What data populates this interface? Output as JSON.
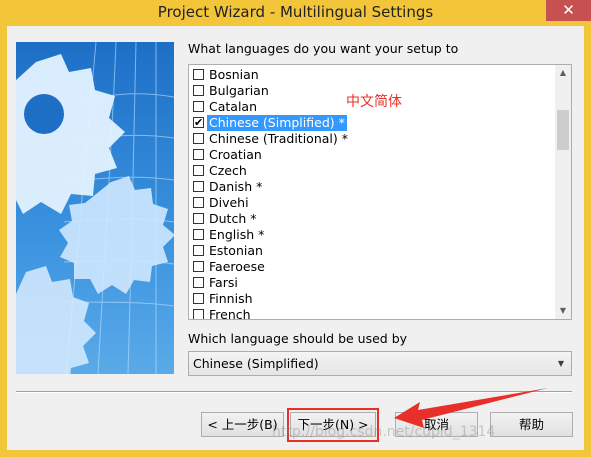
{
  "window": {
    "title": "Project Wizard - Multilingual Settings",
    "close_glyph": "✕"
  },
  "prompt": "What languages do you want your setup to",
  "languages": [
    {
      "label": "Bosnian",
      "checked": false,
      "selected": false
    },
    {
      "label": "Bulgarian",
      "checked": false,
      "selected": false
    },
    {
      "label": "Catalan",
      "checked": false,
      "selected": false
    },
    {
      "label": "Chinese (Simplified) *",
      "checked": true,
      "selected": true
    },
    {
      "label": "Chinese (Traditional) *",
      "checked": false,
      "selected": false
    },
    {
      "label": "Croatian",
      "checked": false,
      "selected": false
    },
    {
      "label": "Czech",
      "checked": false,
      "selected": false
    },
    {
      "label": "Danish *",
      "checked": false,
      "selected": false
    },
    {
      "label": "Divehi",
      "checked": false,
      "selected": false
    },
    {
      "label": "Dutch *",
      "checked": false,
      "selected": false
    },
    {
      "label": "English *",
      "checked": false,
      "selected": false
    },
    {
      "label": "Estonian",
      "checked": false,
      "selected": false
    },
    {
      "label": "Faeroese",
      "checked": false,
      "selected": false
    },
    {
      "label": "Farsi",
      "checked": false,
      "selected": false
    },
    {
      "label": "Finnish",
      "checked": false,
      "selected": false
    },
    {
      "label": "French",
      "checked": false,
      "selected": false
    }
  ],
  "scroll": {
    "up": "▲",
    "down": "▼"
  },
  "annotation": "中文简体",
  "default_language": {
    "label": "Which language should be used by",
    "value": "Chinese (Simplified)",
    "arrow": "▼"
  },
  "buttons": {
    "back": "< 上一步(B)",
    "next": "下一步(N) >",
    "cancel": "取消",
    "help": "帮助"
  },
  "watermark": "http://blog.csdn.net/cupid_1314",
  "colors": {
    "title_bar": "#f3c63a",
    "selection": "#3399ff",
    "annotation_red": "#e8302a",
    "banner_blue": "#2f86d8"
  }
}
